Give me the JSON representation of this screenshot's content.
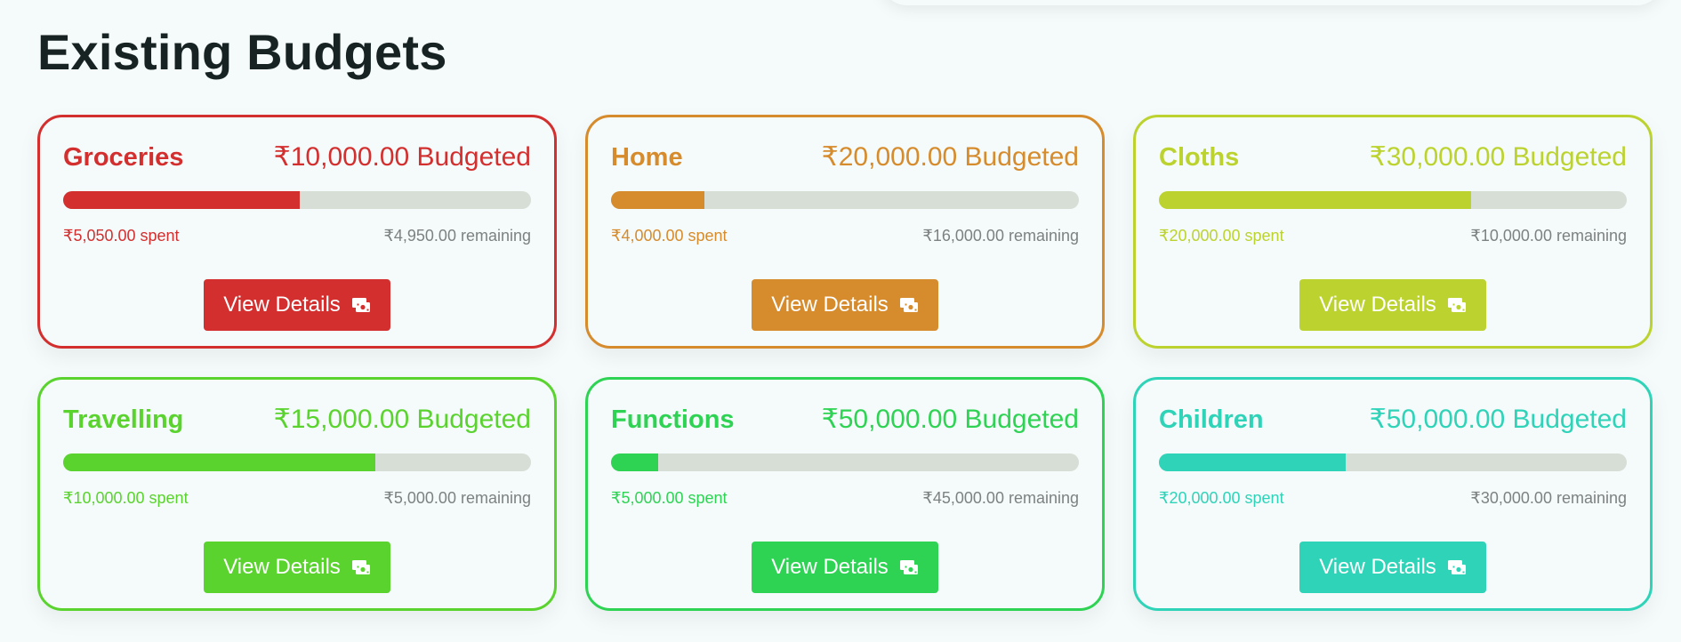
{
  "page": {
    "title": "Existing Budgets"
  },
  "budgets": [
    {
      "name": "Groceries",
      "budgeted": "₹10,000.00 Budgeted",
      "spent": "₹5,050.00 spent",
      "remaining": "₹4,950.00 remaining",
      "progress": 0.505,
      "color": "#d32f2f",
      "button_label": "View Details",
      "button_icon": "cash-icon"
    },
    {
      "name": "Home",
      "budgeted": "₹20,000.00 Budgeted",
      "spent": "₹4,000.00 spent",
      "remaining": "₹16,000.00 remaining",
      "progress": 0.2,
      "color": "#d68b2d",
      "button_label": "View Details",
      "button_icon": "cash-icon"
    },
    {
      "name": "Cloths",
      "budgeted": "₹30,000.00 Budgeted",
      "spent": "₹20,000.00 spent",
      "remaining": "₹10,000.00 remaining",
      "progress": 0.667,
      "color": "#bcd32f",
      "button_label": "View Details",
      "button_icon": "cash-icon"
    },
    {
      "name": "Travelling",
      "budgeted": "₹15,000.00 Budgeted",
      "spent": "₹10,000.00 spent",
      "remaining": "₹5,000.00 remaining",
      "progress": 0.667,
      "color": "#5ad32f",
      "button_label": "View Details",
      "button_icon": "cash-icon"
    },
    {
      "name": "Functions",
      "budgeted": "₹50,000.00 Budgeted",
      "spent": "₹5,000.00 spent",
      "remaining": "₹45,000.00 remaining",
      "progress": 0.1,
      "color": "#2fd354",
      "button_label": "View Details",
      "button_icon": "cash-icon"
    },
    {
      "name": "Children",
      "budgeted": "₹50,000.00 Budgeted",
      "spent": "₹20,000.00 spent",
      "remaining": "₹30,000.00 remaining",
      "progress": 0.4,
      "color": "#2fd3b8",
      "button_label": "View Details",
      "button_icon": "cash-icon"
    }
  ]
}
